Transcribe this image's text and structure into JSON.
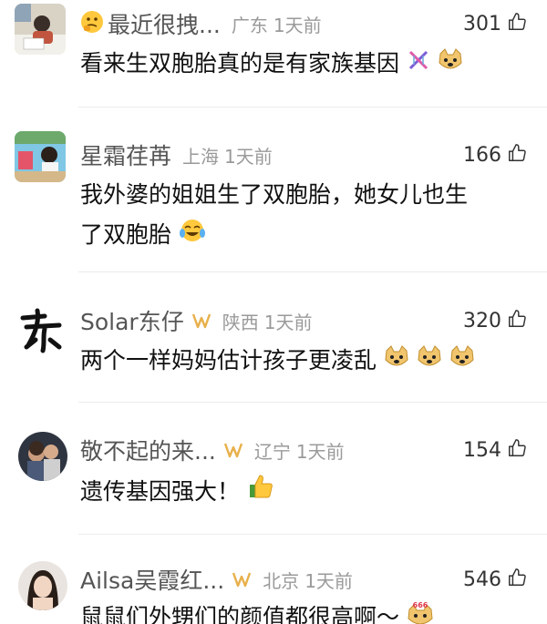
{
  "comments": [
    {
      "username": "最近很拽...",
      "location": "广东",
      "time": "1天前",
      "likes": "301",
      "text": "看来生双胞胎真的是有家族基因",
      "has_name_emoji": true
    },
    {
      "username": "星霜荏苒",
      "location": "上海",
      "time": "1天前",
      "likes": "166",
      "text_line1": "我外婆的姐姐生了双胞胎，她女儿也生",
      "text_line2": "了双胞胎"
    },
    {
      "username": "Solar东仔",
      "location": "陕西",
      "time": "1天前",
      "likes": "320",
      "text": "两个一样妈妈估计孩子更凌乱",
      "avatar_glyph": "东"
    },
    {
      "username": "敬不起的来...",
      "location": "辽宁",
      "time": "1天前",
      "likes": "154",
      "text": "遗传基因强大！"
    },
    {
      "username": "Ailsa吴霞红...",
      "location": "北京",
      "time": "1天前",
      "likes": "546",
      "text": "鼠鼠们外甥们的颜值都很高啊～",
      "emoji_badge": "666"
    }
  ],
  "colors": {
    "badge": "#e8b04a",
    "divider": "#ececec",
    "meta": "#9a9a9a"
  }
}
